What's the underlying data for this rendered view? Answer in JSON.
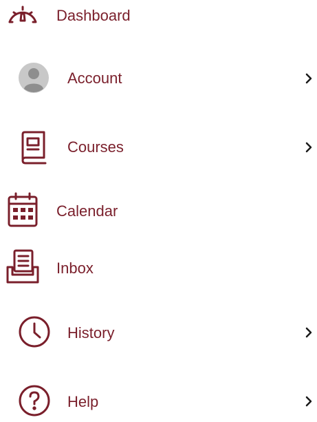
{
  "theme": {
    "accent": "#7a1f2b",
    "avatar_bg": "#c8c8c8",
    "avatar_fg": "#8e8e8e",
    "chevron": "#1a1a1a"
  },
  "menu": {
    "items": [
      {
        "label": "Dashboard",
        "icon": "dashboard-gauge-icon",
        "has_chevron": false
      },
      {
        "label": "Account",
        "icon": "avatar-icon",
        "has_chevron": true
      },
      {
        "label": "Courses",
        "icon": "book-icon",
        "has_chevron": true
      },
      {
        "label": "Calendar",
        "icon": "calendar-icon",
        "has_chevron": false
      },
      {
        "label": "Inbox",
        "icon": "inbox-icon",
        "has_chevron": false
      },
      {
        "label": "History",
        "icon": "clock-icon",
        "has_chevron": true
      },
      {
        "label": "Help",
        "icon": "question-icon",
        "has_chevron": true
      }
    ]
  }
}
